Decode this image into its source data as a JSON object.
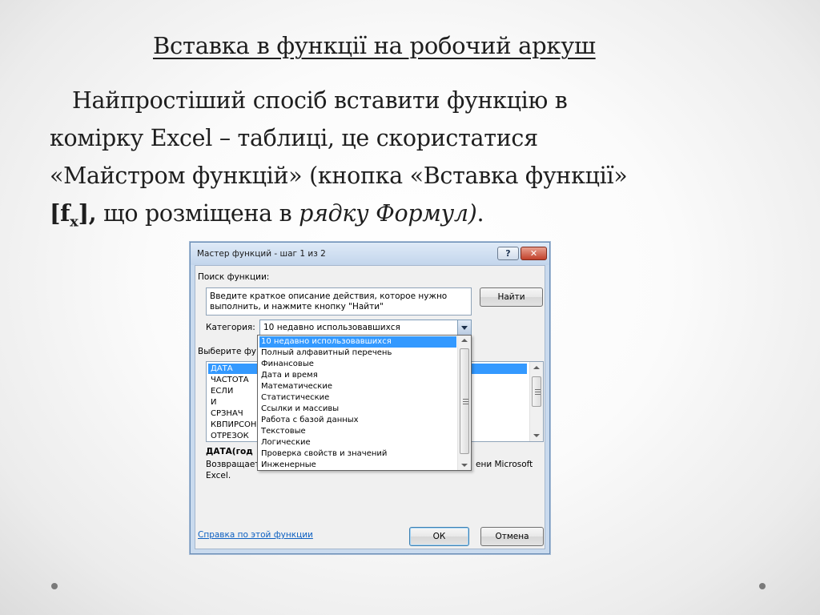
{
  "slide": {
    "title": "Вставка в функції на робочий аркуш",
    "body": {
      "line1": "Найпростіший спосіб вставити функцію в",
      "line2": "комірку Excel – таблиці, це скористатися",
      "line3": "«Майстром функцій» (кнопка «Вставка функції»",
      "fx_open": "[f",
      "fx_sub": "x",
      "fx_close": "],",
      "line4_text": " що розміщена в ",
      "line4_italic": "рядку Формул)",
      "line4_end": "."
    }
  },
  "dialog": {
    "title": "Мастер функций - шаг 1 из 2",
    "help_label": "?",
    "close_label": "✕",
    "search_label": "Поиск функции:",
    "search_text_line1": "Введите краткое описание действия, которое нужно",
    "search_text_line2": "выполнить, и нажмите кнопку \"Найти\"",
    "find_button": "Найти",
    "category_label": "Категория:",
    "category_value": "10 недавно использовавшихся",
    "select_label": "Выберите фу",
    "functions": [
      "ДАТА",
      "ЧАСТОТА",
      "ЕСЛИ",
      "И",
      "СРЗНАЧ",
      "КВПИРСОН",
      "ОТРЕЗОК"
    ],
    "signature": "ДАТА(год",
    "description_start": "Возвращает",
    "description_end": "ени Microsoft",
    "description_line2": "Excel.",
    "help_link": "Справка по этой функции",
    "ok_button": "ОК",
    "cancel_button": "Отмена"
  },
  "category_dropdown": {
    "options": [
      "10 недавно использовавшихся",
      "Полный алфавитный перечень",
      "Финансовые",
      "Дата и время",
      "Математические",
      "Статистические",
      "Ссылки и массивы",
      "Работа с базой данных",
      "Текстовые",
      "Логические",
      "Проверка свойств и значений",
      "Инженерные"
    ],
    "selected_index": 0
  },
  "colors": {
    "selection": "#3399ff",
    "link": "#0c5fc1",
    "dialog_frame": "#c9daee"
  }
}
